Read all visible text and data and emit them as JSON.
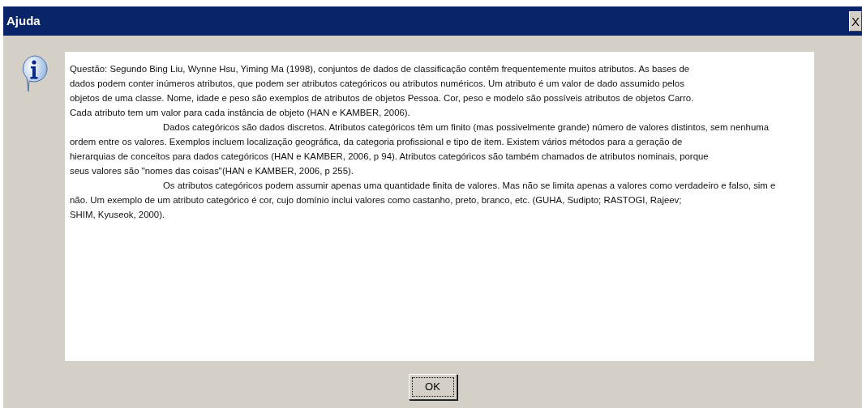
{
  "window": {
    "title": "Ajuda",
    "close_label": "X"
  },
  "message": {
    "paragraphs": [
      {
        "indented": false,
        "text": "Questão: Segundo Bing Liu, Wynne Hsu, Yiming Ma (1998), conjuntos de dados de classificação contêm frequentemente muitos atributos. As bases de\ndados podem conter inúmeros atributos, que podem ser atributos categóricos ou atributos numéricos. Um atributo é um valor de dado assumido pelos\nobjetos de uma classe. Nome, idade e peso são exemplos de atributos de objetos Pessoa. Cor, peso e modelo são possíveis atributos de objetos Carro.\nCada atributo tem um valor para cada instância de objeto (HAN e KAMBER, 2006)."
      },
      {
        "indented": true,
        "text": "Dados categóricos são dados discretos. Atributos categóricos têm um finito (mas possivelmente grande) número de valores distintos, sem nenhuma\nordem entre os valores. Exemplos incluem localização geográfica, da categoria profissional e tipo de item. Existem vários métodos para a geração de\nhierarquias de conceitos para dados categóricos (HAN e KAMBER, 2006, p 94). Atributos categóricos são também chamados de atributos nominais, porque\nseus valores são \"nomes das coisas\"(HAN e KAMBER, 2006, p 255)."
      },
      {
        "indented": true,
        "text": "Os atributos categóricos podem assumir apenas uma quantidade finita de valores. Mas não se limita apenas a valores como verdadeiro e falso, sim e\nnão. Um exemplo de um atributo categórico é cor, cujo domínio inclui valores como castanho, preto, branco, etc. (GUHA, Sudipto; RASTOGI, Rajeev;\nSHIM, Kyuseok, 2000)."
      }
    ]
  },
  "buttons": [
    {
      "label": "OK",
      "focused": true
    }
  ]
}
